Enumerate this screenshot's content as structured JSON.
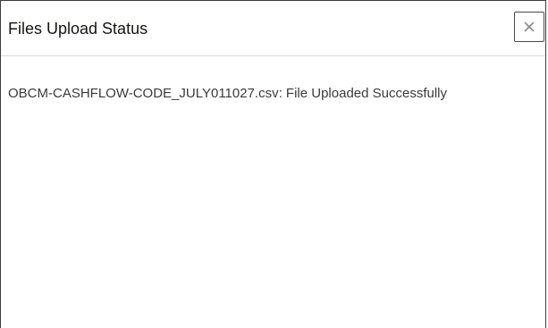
{
  "dialog": {
    "title": "Files Upload Status",
    "close_label": "Close"
  },
  "upload": {
    "message": "OBCM-CASHFLOW-CODE_JULY011027.csv: File Uploaded Successfully"
  },
  "icons": {
    "close": "close-icon"
  },
  "colors": {
    "border": "#3c3c3c",
    "divider": "#d9d9d9",
    "text": "#161513"
  }
}
